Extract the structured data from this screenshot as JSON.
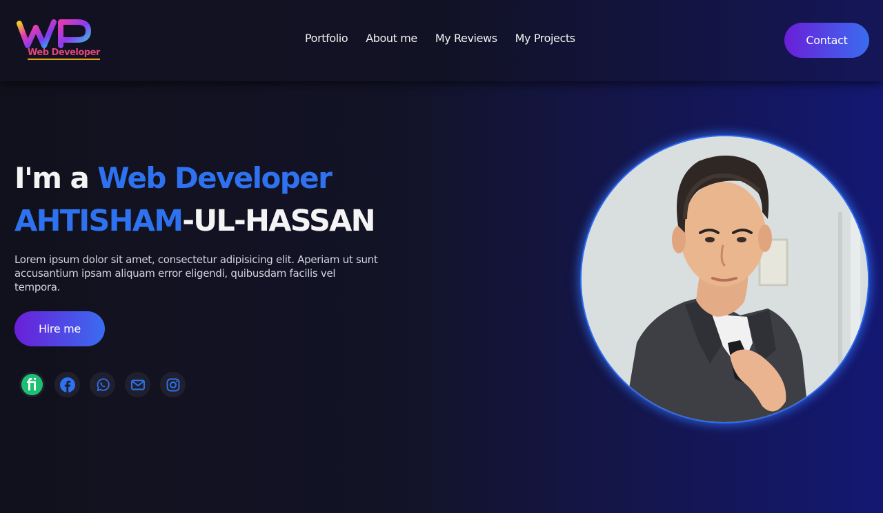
{
  "logo": {
    "text": "Web Developer"
  },
  "nav": {
    "items": [
      {
        "label": "Portfolio"
      },
      {
        "label": "About me"
      },
      {
        "label": "My Reviews"
      },
      {
        "label": "My Projects"
      }
    ]
  },
  "header": {
    "contact_label": "Contact"
  },
  "hero": {
    "line1_prefix": "I'm a ",
    "line1_accent": "Web Developer",
    "name_accent": "AHTISHAM",
    "name_rest": "-UL-HASSAN",
    "description": "Lorem ipsum dolor sit amet, consectetur adipisicing elit. Aperiam ut sunt accusantium ipsam aliquam error eligendi, quibusdam facilis vel tempora.",
    "hire_label": "Hire me"
  },
  "socials": [
    {
      "icon": "fiverr-icon"
    },
    {
      "icon": "facebook-icon"
    },
    {
      "icon": "whatsapp-icon"
    },
    {
      "icon": "mail-icon"
    },
    {
      "icon": "instagram-icon"
    }
  ],
  "colors": {
    "accent": "#2f72ef",
    "button_gradient_start": "#6a1fd8",
    "button_gradient_end": "#3a6cf0",
    "fiverr": "#1dbf73",
    "background": "#11111d"
  }
}
